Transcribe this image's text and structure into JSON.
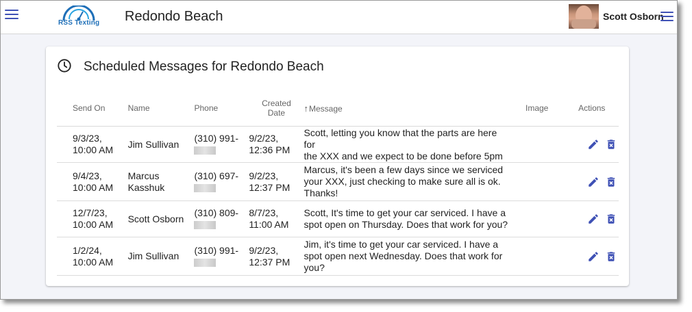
{
  "header": {
    "logo_text": "RSS Texting",
    "title": "Redondo Beach",
    "user_name": "Scott Osborn"
  },
  "card": {
    "title": "Scheduled Messages for Redondo Beach"
  },
  "table": {
    "columns": {
      "send_on": "Send On",
      "name": "Name",
      "phone": "Phone",
      "created_line1": "Created",
      "created_line2": "Date",
      "message": "Message",
      "image": "Image",
      "actions": "Actions"
    },
    "rows": [
      {
        "send_on_1": "9/3/23,",
        "send_on_2": "10:00 AM",
        "name_1": "Jim Sullivan",
        "name_2": "",
        "phone_1": "(310) 991-",
        "created_1": "9/2/23,",
        "created_2": "12:36 PM",
        "message_1": "Scott, letting you know that the parts are here for",
        "message_2": "the XXX and we expect to be done before 5pm",
        "message_3": ""
      },
      {
        "send_on_1": "9/4/23,",
        "send_on_2": "10:00 AM",
        "name_1": "Marcus",
        "name_2": "Kasshuk",
        "phone_1": "(310) 697-",
        "created_1": "9/2/23,",
        "created_2": "12:37 PM",
        "message_1": "Marcus, it's been a few days since we serviced",
        "message_2": "your XXX, just checking to make sure all is ok.",
        "message_3": "Thanks!"
      },
      {
        "send_on_1": "12/7/23,",
        "send_on_2": "10:00 AM",
        "name_1": "Scott Osborn",
        "name_2": "",
        "phone_1": "(310) 809-",
        "created_1": "8/7/23,",
        "created_2": "11:00 AM",
        "message_1": "Scott, It's time to get your car serviced. I have a",
        "message_2": "spot open on Thursday. Does that work for you?",
        "message_3": ""
      },
      {
        "send_on_1": "1/2/24,",
        "send_on_2": "10:00 AM",
        "name_1": "Jim Sullivan",
        "name_2": "",
        "phone_1": "(310) 991-",
        "created_1": "9/2/23,",
        "created_2": "12:37 PM",
        "message_1": "Jim, it's time to get your car serviced. I have a",
        "message_2": "spot open next Wednesday. Does that work for",
        "message_3": "you?"
      }
    ]
  },
  "icons": {
    "menu": "hamburger-menu-icon",
    "clock": "clock-icon",
    "sort": "arrow-up-icon",
    "edit": "pencil-icon",
    "delete": "delete-x-icon"
  },
  "colors": {
    "accent": "#3f51b5",
    "page_bg": "#f3f4f9"
  }
}
